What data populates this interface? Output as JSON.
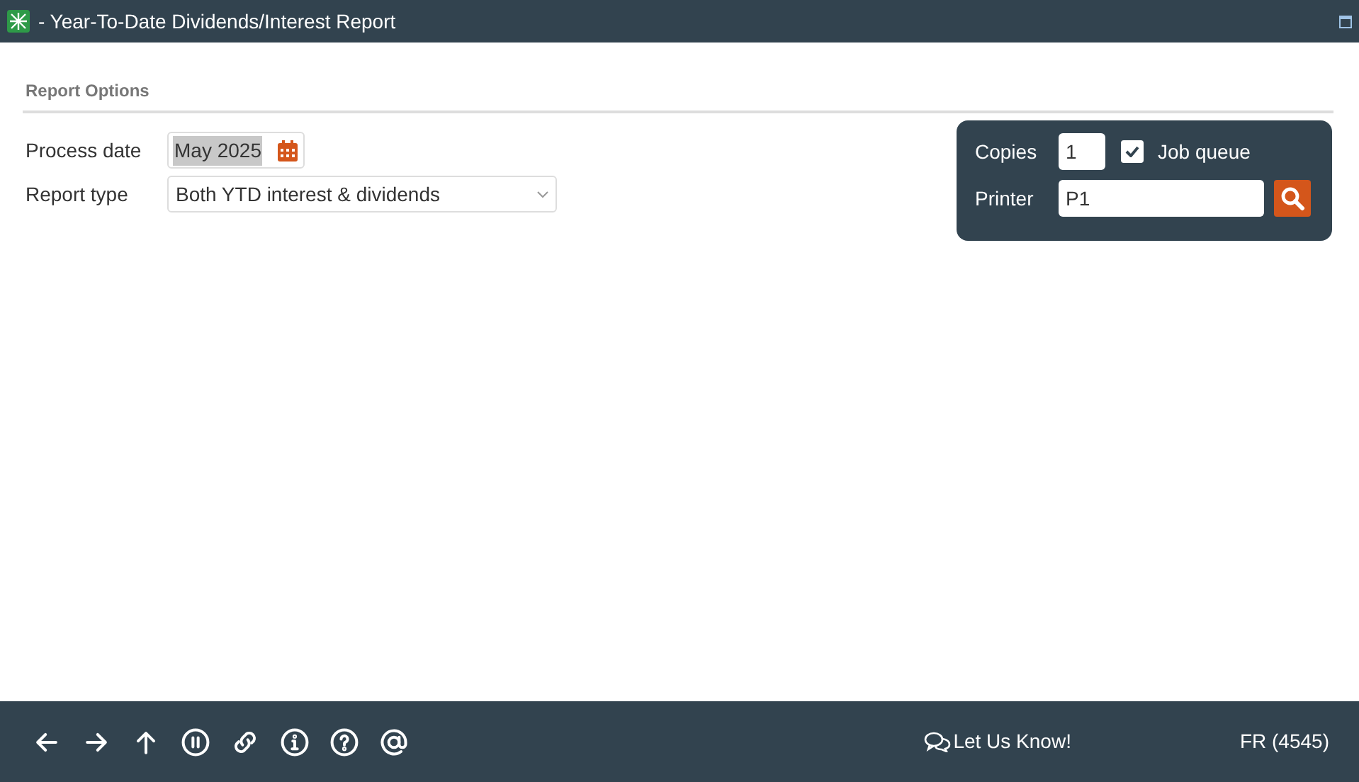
{
  "window": {
    "title": "- Year-To-Date Dividends/Interest Report"
  },
  "section": {
    "title": "Report Options"
  },
  "fields": [
    {
      "kind": "date",
      "label": "Process date",
      "value": "May 2025",
      "highlighted": true
    },
    {
      "kind": "select",
      "label": "Report type",
      "value": "Both YTD interest & dividends"
    }
  ],
  "print_panel": {
    "copies_label": "Copies",
    "copies": "1",
    "job_queue": {
      "label": "Job queue",
      "checked": true
    },
    "printer_label": "Printer",
    "printer": "P1"
  },
  "footer": {
    "nav": [
      {
        "kind": "back"
      },
      {
        "kind": "forward"
      },
      {
        "kind": "up"
      },
      {
        "kind": "pause"
      },
      {
        "kind": "link"
      },
      {
        "kind": "info"
      },
      {
        "kind": "help"
      },
      {
        "kind": "email"
      }
    ],
    "feedback": "Let Us Know!",
    "user": "FR (4545)"
  }
}
